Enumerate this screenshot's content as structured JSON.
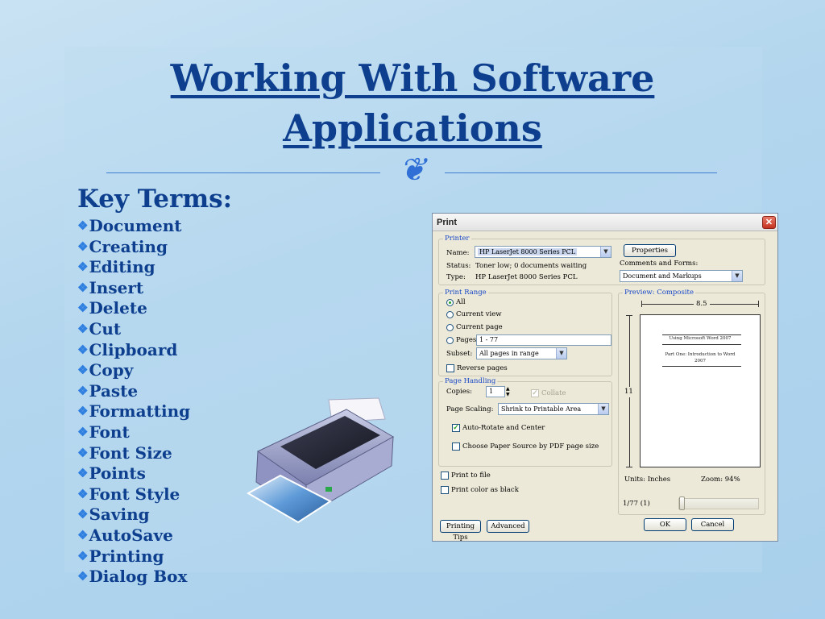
{
  "slide": {
    "title_line1": "Working With Software",
    "title_line2": "Applications",
    "ornament": "❦",
    "key_terms_heading": "Key Terms:",
    "bullet_glyph": "❖",
    "terms": [
      "Document",
      "Creating",
      "Editing",
      "Insert",
      "Delete",
      "Cut",
      "Clipboard",
      "Copy",
      "Paste",
      "Formatting",
      "Font",
      "Font Size",
      "Points",
      "Font Style",
      "Saving",
      "AutoSave",
      "Printing",
      "Dialog Box"
    ]
  },
  "dialog": {
    "title": "Print",
    "close_glyph": "✕",
    "printer": {
      "group_label": "Printer",
      "name_label": "Name:",
      "name_value": "HP LaserJet 8000 Series PCL",
      "status_label": "Status:",
      "status_value": "Toner low; 0 documents waiting",
      "type_label": "Type:",
      "type_value": "HP LaserJet 8000 Series PCL",
      "properties_button": "Properties",
      "comments_label": "Comments and Forms:",
      "comments_value": "Document and Markups"
    },
    "print_range": {
      "group_label": "Print Range",
      "all": "All",
      "current_view": "Current view",
      "current_page": "Current page",
      "pages": "Pages",
      "pages_value": "1 - 77",
      "subset_label": "Subset:",
      "subset_value": "All pages in range",
      "reverse_pages": "Reverse pages"
    },
    "page_handling": {
      "group_label": "Page Handling",
      "copies_label": "Copies:",
      "copies_value": "1",
      "collate": "Collate",
      "page_scaling_label": "Page Scaling:",
      "page_scaling_value": "Shrink to Printable Area",
      "auto_rotate": "Auto-Rotate and Center",
      "choose_paper": "Choose Paper Source by PDF page size"
    },
    "print_to_file": "Print to file",
    "print_color_black": "Print color as black",
    "preview": {
      "group_label": "Preview: Composite",
      "width_label": "8.5",
      "height_label": "11",
      "page_header": "Using Microsoft Word 2007",
      "page_title_1": "Part One: Introduction to Word",
      "page_title_2": "2007",
      "units": "Units: Inches",
      "zoom": "Zoom:  94%",
      "page_counter": "1/77 (1)",
      "slider_position": 0
    },
    "buttons": {
      "printing_tips": "Printing Tips",
      "advanced": "Advanced",
      "ok": "OK",
      "cancel": "Cancel"
    },
    "checked": "✓"
  },
  "colors": {
    "title_blue": "#0d3f8e",
    "bullet_blue": "#2f7fe0",
    "group_label_blue": "#1646c6"
  }
}
